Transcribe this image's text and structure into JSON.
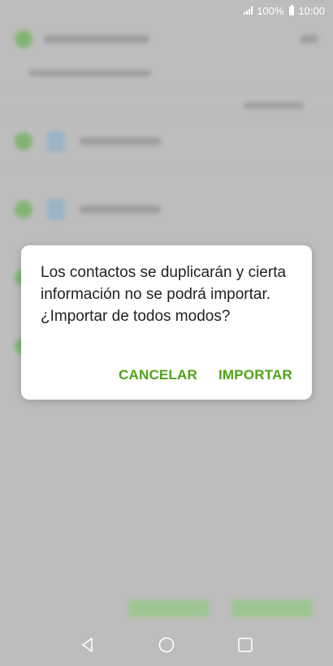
{
  "status_bar": {
    "battery_text": "100%",
    "time": "10:00",
    "icons": [
      "signal-icon",
      "battery-icon"
    ]
  },
  "dialog": {
    "message": "Los contactos se duplicarán y cierta información no se podrá importar. ¿Importar de todos modos?",
    "cancel_label": "CANCELAR",
    "import_label": "IMPORTAR",
    "accent_color": "#4ea318"
  },
  "nav_bar": {
    "icons": [
      "back-icon",
      "home-icon",
      "recents-icon"
    ]
  }
}
